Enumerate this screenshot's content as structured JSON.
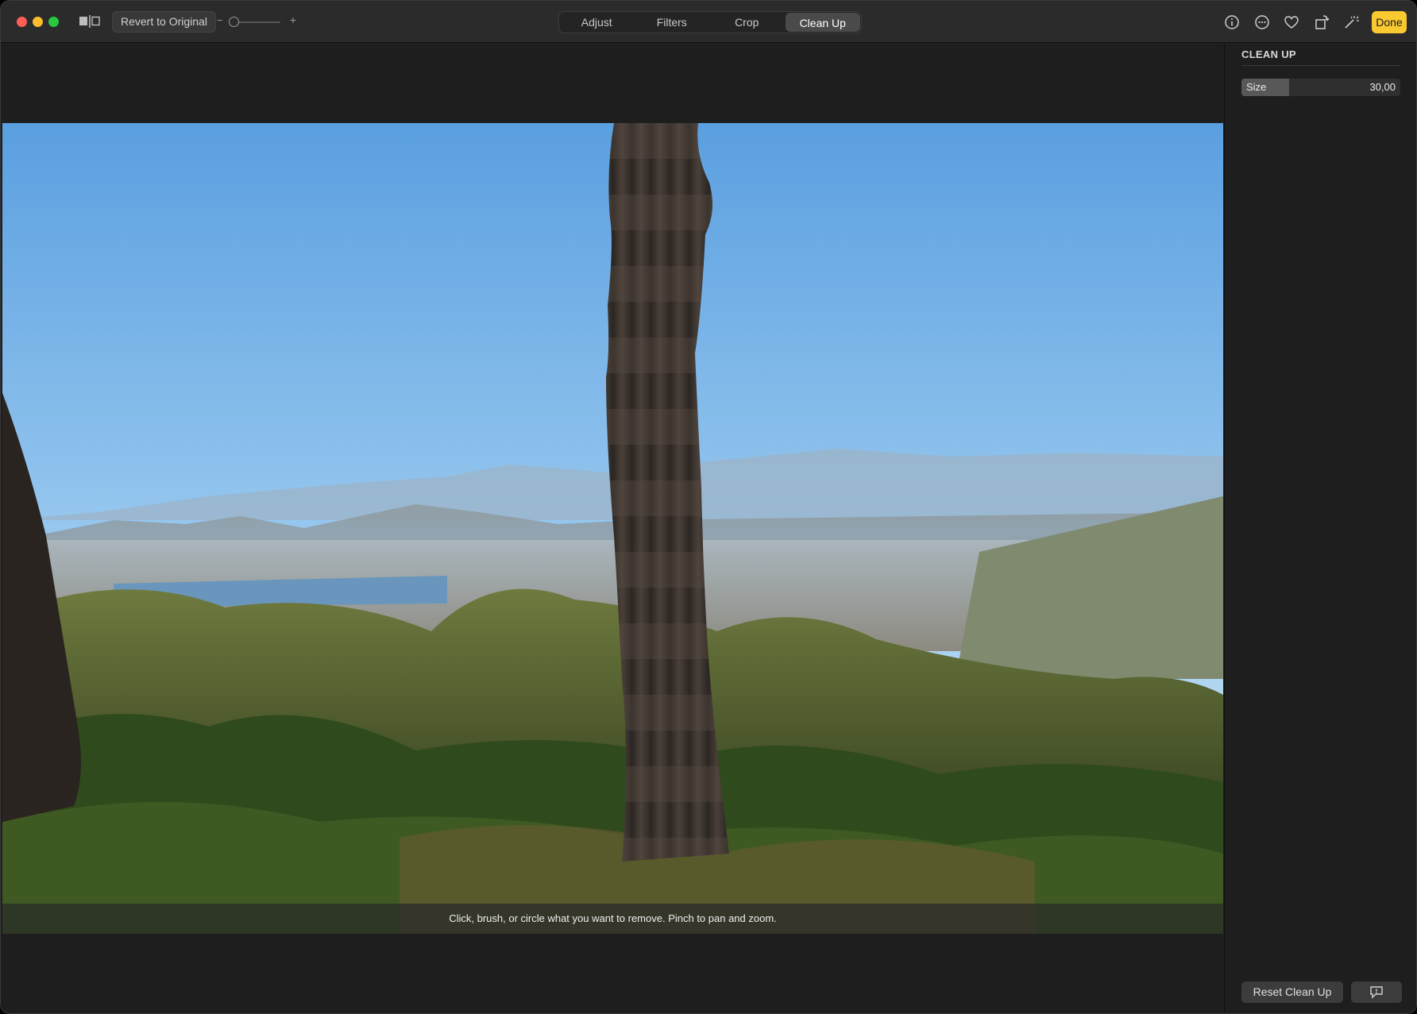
{
  "window": {
    "controls": [
      "close",
      "minimize",
      "zoom"
    ]
  },
  "toolbar": {
    "revert_label": "Revert to Original",
    "zoom_minus": "−",
    "zoom_plus": "+",
    "zoom_level": 0.02,
    "tabs": [
      {
        "label": "Adjust",
        "active": false
      },
      {
        "label": "Filters",
        "active": false
      },
      {
        "label": "Crop",
        "active": false
      },
      {
        "label": "Clean Up",
        "active": true
      }
    ],
    "icons": [
      "info-icon",
      "more-icon",
      "heart-icon",
      "rotate-icon",
      "magic-wand-icon"
    ],
    "done_label": "Done"
  },
  "canvas": {
    "hint": "Click, brush, or circle what you want to remove. Pinch to pan and zoom."
  },
  "panel": {
    "title": "CLEAN UP",
    "size_label": "Size",
    "size_value": "30,00",
    "size_fraction": 0.3,
    "reset_label": "Reset Clean Up",
    "feedback_icon": "feedback-icon"
  },
  "colors": {
    "accent": "#f9c930",
    "toolbar_bg": "#2b2b2b",
    "panel_bg": "#1e1e1e"
  }
}
